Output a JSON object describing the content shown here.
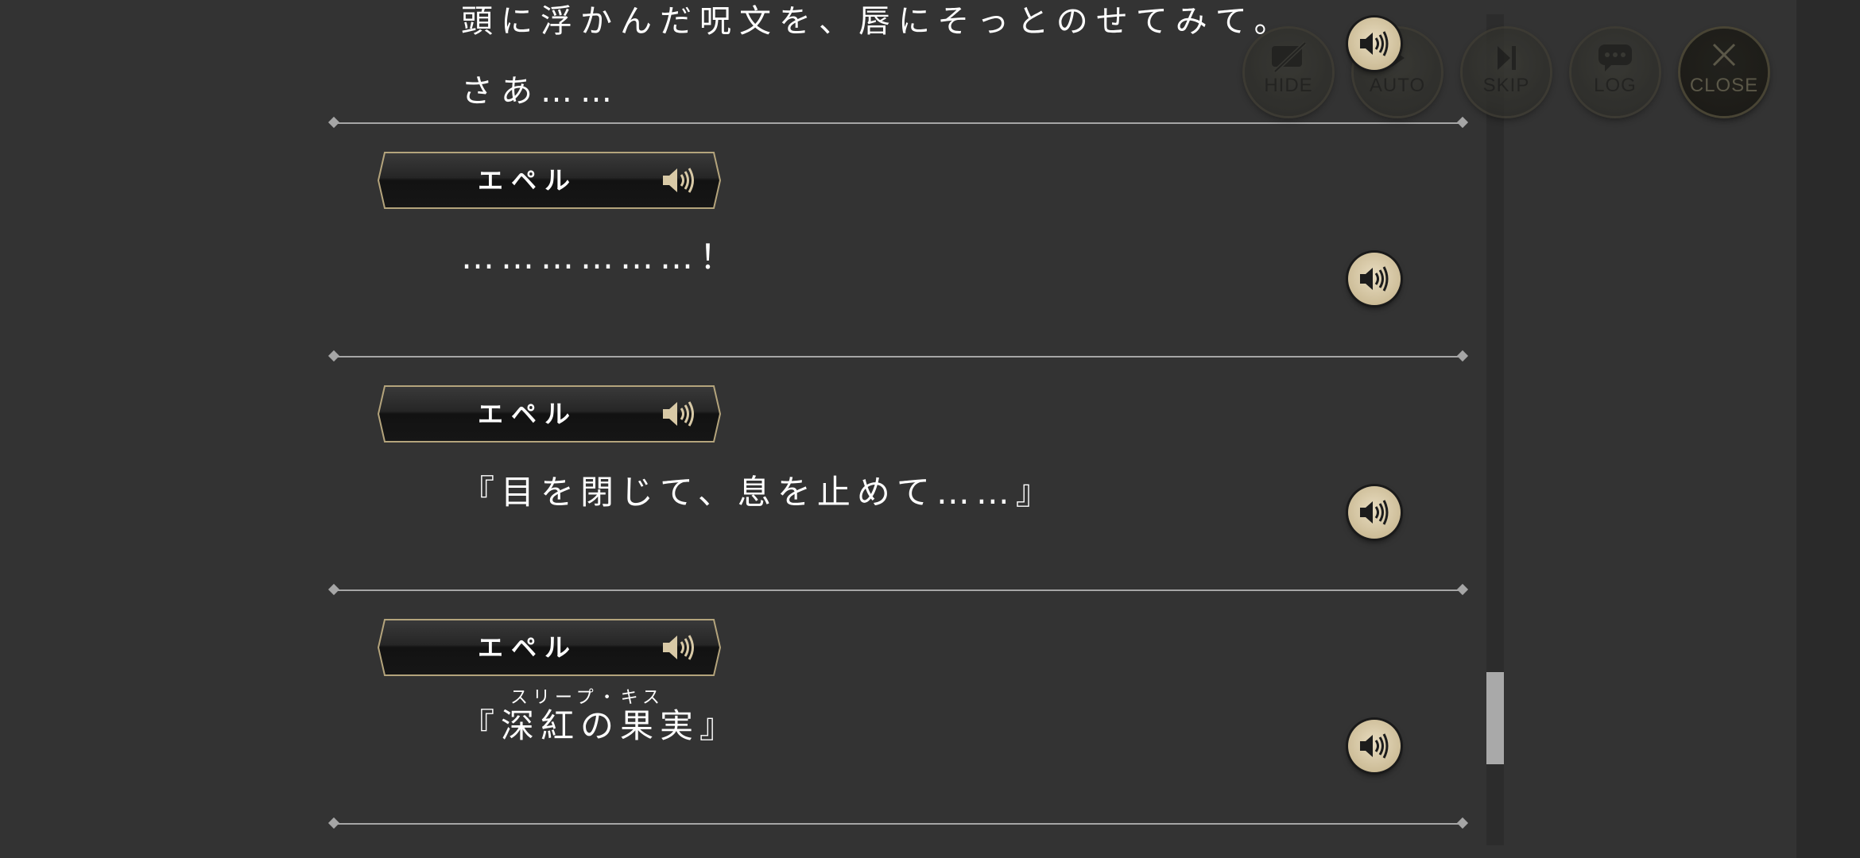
{
  "toolbar": {
    "hide_label": "HIDE",
    "auto_label": "AUTO",
    "skip_label": "SKIP",
    "log_label": "LOG",
    "close_label": "CLOSE"
  },
  "log": {
    "partial_entry": {
      "line1": "頭に浮かんだ呪文を、唇にそっとのせてみて。",
      "line2": "さあ……"
    },
    "entries": [
      {
        "speaker": "エペル",
        "text": "………………！"
      },
      {
        "speaker": "エペル",
        "text": "『目を閉じて、息を止めて……』"
      },
      {
        "speaker": "エペル",
        "ruby": "スリープ・キス",
        "text": "『深紅の果実』"
      }
    ]
  },
  "scrollbar": {
    "position_fraction": 0.89
  },
  "colors": {
    "background": "#333333",
    "accent_gold": "#cdbd98",
    "separator": "#a6a6a6",
    "text": "#ffffff"
  },
  "icons": {
    "voice": "speaker-icon",
    "hide": "hide-icon",
    "auto": "auto-icon",
    "skip": "skip-icon",
    "log": "chat-bubble-icon",
    "close": "close-icon"
  }
}
